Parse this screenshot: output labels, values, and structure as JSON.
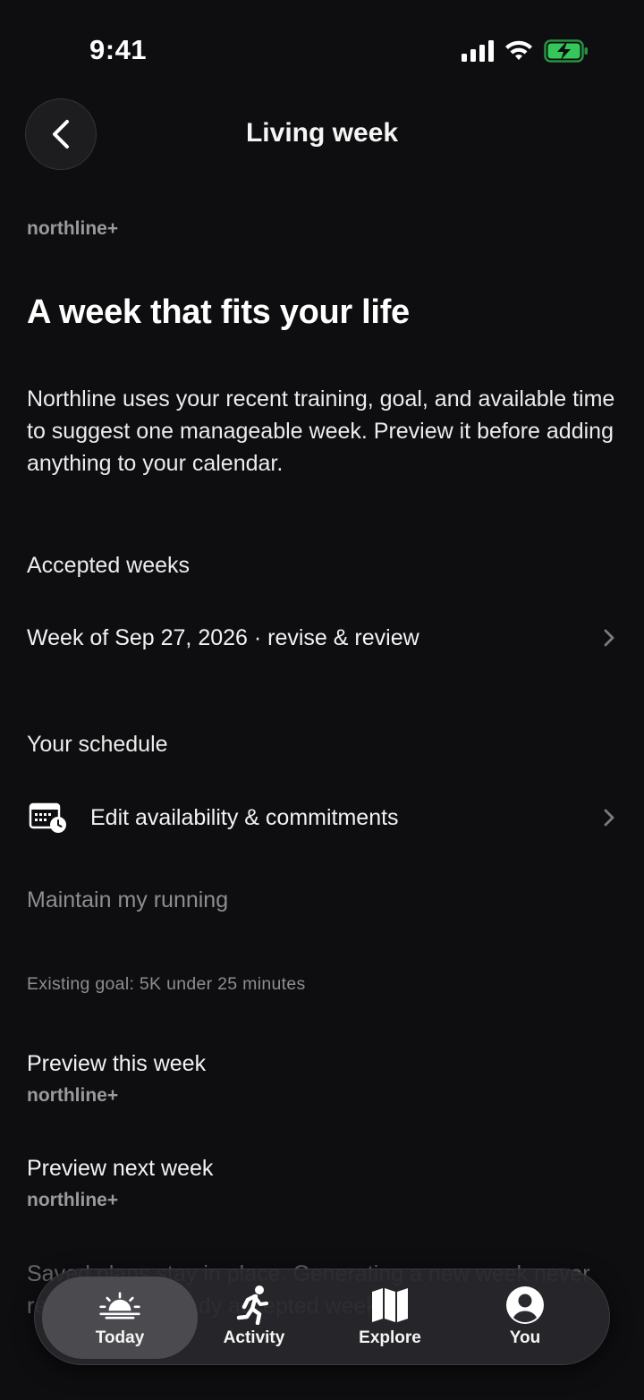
{
  "status_bar": {
    "time": "9:41"
  },
  "nav": {
    "title": "Living week"
  },
  "brand_tag": "northline+",
  "headline": "A week that fits your life",
  "intro": "Northline uses your recent training, goal, and available time to suggest one manageable week. Preview it before adding anything to your calendar.",
  "accepted_weeks": {
    "label": "Accepted weeks",
    "item": "Week of Sep 27, 2026 · revise & review"
  },
  "schedule": {
    "label": "Your schedule",
    "edit_label": "Edit availability & commitments"
  },
  "goal_mode": "Maintain my running",
  "existing_goal": "Existing goal: 5K under 25 minutes",
  "previews": [
    {
      "title": "Preview this week",
      "tag": "northline+"
    },
    {
      "title": "Preview next week",
      "tag": "northline+"
    }
  ],
  "footer_note": "Saved plans stay in place. Generating a new week never replaces an already accepted week.",
  "tabs": [
    {
      "label": "Today",
      "icon": "sunrise-icon",
      "active": true
    },
    {
      "label": "Activity",
      "icon": "runner-icon",
      "active": false
    },
    {
      "label": "Explore",
      "icon": "map-icon",
      "active": false
    },
    {
      "label": "You",
      "icon": "profile-icon",
      "active": false
    }
  ],
  "colors": {
    "background": "#0e0e10",
    "battery": "#34c759",
    "muted": "#8d8d92"
  }
}
